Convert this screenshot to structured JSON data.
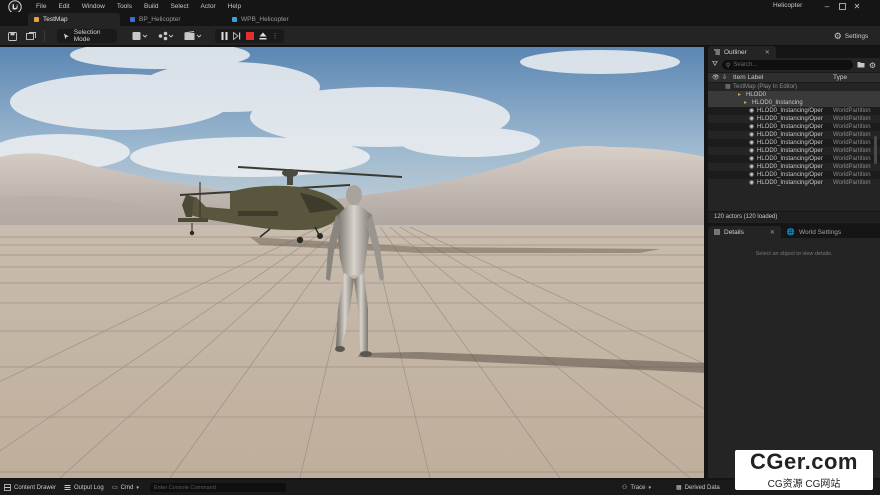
{
  "menu": [
    "File",
    "Edit",
    "Window",
    "Tools",
    "Build",
    "Select",
    "Actor",
    "Help"
  ],
  "app_title": "Helicopter",
  "tabs": [
    {
      "label": "TestMap",
      "active": true,
      "color": "#e8a23a"
    },
    {
      "label": "BP_Helicopter",
      "active": false,
      "color": "#3a6fd8"
    },
    {
      "label": "WPB_Helicopter",
      "active": false,
      "color": "#3aa0d8"
    }
  ],
  "toolbar": {
    "selection_mode": "Selection Mode",
    "settings": "Settings"
  },
  "outliner": {
    "tab_label": "Outliner",
    "search_placeholder": "Search...",
    "col_label": "Item Label",
    "col_type": "Type",
    "rows": [
      {
        "name": "TestMap (Play In Editor)",
        "type": "",
        "indent": 0,
        "kind": "map"
      },
      {
        "name": "HLOD0",
        "type": "",
        "indent": 1,
        "kind": "folder"
      },
      {
        "name": "HLOD0_Instancing",
        "type": "",
        "indent": 2,
        "kind": "folder"
      },
      {
        "name": "HLOD0_Instancing/Oper",
        "type": "WorldPartition",
        "indent": 3,
        "kind": "actor"
      },
      {
        "name": "HLOD0_Instancing/Oper",
        "type": "WorldPartition",
        "indent": 3,
        "kind": "actor"
      },
      {
        "name": "HLOD0_Instancing/Oper",
        "type": "WorldPartition",
        "indent": 3,
        "kind": "actor"
      },
      {
        "name": "HLOD0_Instancing/Oper",
        "type": "WorldPartition",
        "indent": 3,
        "kind": "actor"
      },
      {
        "name": "HLOD0_Instancing/Oper",
        "type": "WorldPartition",
        "indent": 3,
        "kind": "actor"
      },
      {
        "name": "HLOD0_Instancing/Oper",
        "type": "WorldPartition",
        "indent": 3,
        "kind": "actor"
      },
      {
        "name": "HLOD0_Instancing/Oper",
        "type": "WorldPartition",
        "indent": 3,
        "kind": "actor"
      },
      {
        "name": "HLOD0_Instancing/Oper",
        "type": "WorldPartition",
        "indent": 3,
        "kind": "actor"
      },
      {
        "name": "HLOD0_Instancing/Oper",
        "type": "WorldPartition",
        "indent": 3,
        "kind": "actor"
      },
      {
        "name": "HLOD0_Instancing/Oper",
        "type": "WorldPartition",
        "indent": 3,
        "kind": "actor"
      }
    ],
    "status": "120 actors (120 loaded)"
  },
  "details": {
    "tab_label": "Details",
    "world_settings_label": "World Settings",
    "empty_message": "Select an object to view details."
  },
  "bottom": {
    "content_drawer": "Content Drawer",
    "output_log": "Output Log",
    "cmd": "Cmd",
    "console_placeholder": "Enter Console Command",
    "trace": "Trace",
    "derived_data": "Derived Data"
  },
  "watermark": {
    "main": "CGer.com",
    "sub": "CG资源 CG网站"
  }
}
